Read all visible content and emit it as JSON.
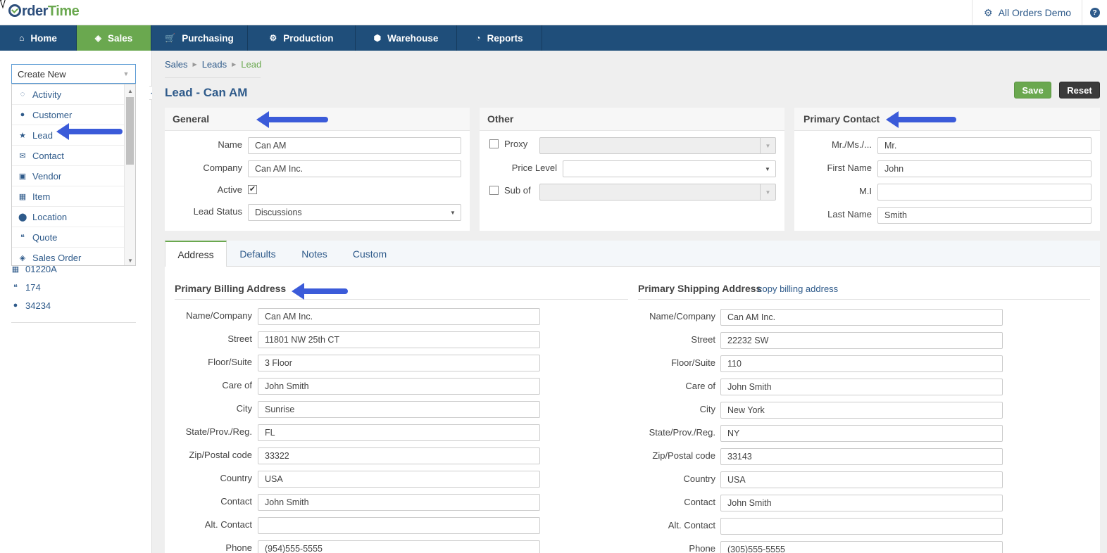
{
  "app": {
    "logo_part1": "rder",
    "logo_part2": "Time",
    "account": "All Orders Demo",
    "help": "?"
  },
  "nav": [
    {
      "label": "Home",
      "icon": "home-icon",
      "glyph": "⌂"
    },
    {
      "label": "Sales",
      "icon": "tag-icon",
      "glyph": "◈"
    },
    {
      "label": "Purchasing",
      "icon": "cart-icon",
      "glyph": "🛒"
    },
    {
      "label": "Production",
      "icon": "cogs-icon",
      "glyph": "⚙"
    },
    {
      "label": "Warehouse",
      "icon": "cube-icon",
      "glyph": "⬢"
    },
    {
      "label": "Reports",
      "icon": "pie-chart-icon",
      "glyph": "◔"
    }
  ],
  "sidebar": {
    "create_new": "Create New",
    "menu": [
      {
        "label": "Activity",
        "icon": "spinner-icon",
        "glyph": "◌"
      },
      {
        "label": "Customer",
        "icon": "user-icon",
        "glyph": "●"
      },
      {
        "label": "Lead",
        "icon": "star-icon",
        "glyph": "★"
      },
      {
        "label": "Contact",
        "icon": "envelope-icon",
        "glyph": "✉"
      },
      {
        "label": "Vendor",
        "icon": "archive-icon",
        "glyph": "▣"
      },
      {
        "label": "Item",
        "icon": "grid-icon",
        "glyph": "▦"
      },
      {
        "label": "Location",
        "icon": "map-marker-icon",
        "glyph": "⬤"
      },
      {
        "label": "Quote",
        "icon": "quote-icon",
        "glyph": "❝"
      },
      {
        "label": "Sales Order",
        "icon": "tag-icon",
        "glyph": "◈"
      }
    ],
    "recent": [
      {
        "label": "01220A",
        "icon": "grid-icon",
        "glyph": "▦"
      },
      {
        "label": "174",
        "icon": "quote-icon",
        "glyph": "❝"
      },
      {
        "label": "34234",
        "icon": "user-icon",
        "glyph": "●"
      }
    ]
  },
  "breadcrumb": [
    "Sales",
    "Leads",
    "Lead"
  ],
  "page_title": "Lead - Can AM",
  "buttons": {
    "save": "Save",
    "reset": "Reset"
  },
  "general": {
    "title": "General",
    "name_label": "Name",
    "name": "Can AM",
    "company_label": "Company",
    "company": "Can AM Inc.",
    "active_label": "Active",
    "active": "✔",
    "status_label": "Lead Status",
    "status": "Discussions"
  },
  "other": {
    "title": "Other",
    "proxy_label": "Proxy",
    "proxy": "",
    "price_level_label": "Price Level",
    "price_level": "",
    "sub_of_label": "Sub of",
    "sub_of": ""
  },
  "contact": {
    "title": "Primary Contact",
    "salutation_label": "Mr./Ms./...",
    "salutation": "Mr.",
    "first_label": "First Name",
    "first": "John",
    "mi_label": "M.I",
    "mi": "",
    "last_label": "Last Name",
    "last": "Smith"
  },
  "tabs": [
    "Address",
    "Defaults",
    "Notes",
    "Custom"
  ],
  "address_labels": [
    "Name/Company",
    "Street",
    "Floor/Suite",
    "Care of",
    "City",
    "State/Prov./Reg.",
    "Zip/Postal code",
    "Country",
    "Contact",
    "Alt. Contact",
    "Phone"
  ],
  "billing": {
    "title": "Primary Billing Address",
    "values": [
      "Can AM Inc.",
      "11801 NW 25th CT",
      "3 Floor",
      "John Smith",
      "Sunrise",
      "FL",
      "33322",
      "USA",
      "John Smith",
      "",
      "(954)555-5555"
    ]
  },
  "shipping": {
    "title": "Primary Shipping Address",
    "copy_link": "copy billing address",
    "values": [
      "Can AM Inc.",
      "22232 SW",
      "110",
      "John Smith",
      "New York",
      "NY",
      "33143",
      "USA",
      "John Smith",
      "",
      "(305)555-5555"
    ]
  }
}
